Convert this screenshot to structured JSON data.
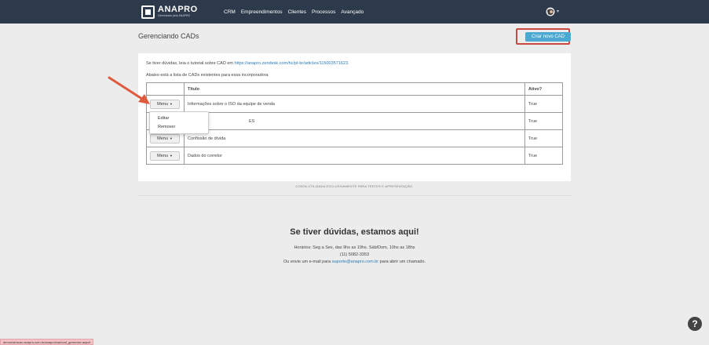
{
  "nav": {
    "logo_name": "ANAPRO",
    "logo_sub": "Gerenciado pela ANAPRO",
    "links": [
      "CRM",
      "Empreendimentos",
      "Clientes",
      "Processos",
      "Avançado"
    ],
    "avatar_icon": "user-avatar-icon"
  },
  "header": {
    "title": "Gerenciando CADs",
    "new_button": "Criar novo CAD",
    "highlight_color": "#c9483f",
    "button_color": "#4ba8d1"
  },
  "content": {
    "help_prefix": "Se tiver dúvidas, leia o tutorial sobre CAD em",
    "help_link": "https://anapro.zendesk.com/hc/pt-br/articles/115003571623.",
    "intro": "Abaixo está a lista de CADs existentes para essa incorporadora"
  },
  "table": {
    "headers": [
      "",
      "Título",
      "Ativo?"
    ],
    "menu_label": "Menu",
    "rows": [
      {
        "title": "Informações sobre o ISO da equipe de venda",
        "active": "True"
      },
      {
        "title": "ES",
        "active": "True"
      },
      {
        "title": "Confissão de dívida",
        "active": "True"
      },
      {
        "title": "Dados do corretor",
        "active": "True"
      }
    ]
  },
  "dropdown": {
    "items": [
      "Editar",
      "Remover"
    ]
  },
  "test_note": "CONTA UTILIZADA EXCLUSIVAMENTE PARA TESTES E APRESENTAÇÃO.",
  "footer": {
    "title": "Se tiver dúvidas, estamos aqui!",
    "hours": "Horários: Seg a Sex, das 9hs as 19hs. Sáb/Dom, 10hs as 18hs",
    "phone": "(11) 5082-3353",
    "email_prefix": "Ou envie um e-mail para",
    "email": "suporte@anapro.com.br",
    "email_suffix": "para abrir um chamado."
  },
  "help_button": "?",
  "status_url": "demonstracao.anapro.com.br/anapro/cad/cad_gerenciar.aspx#"
}
